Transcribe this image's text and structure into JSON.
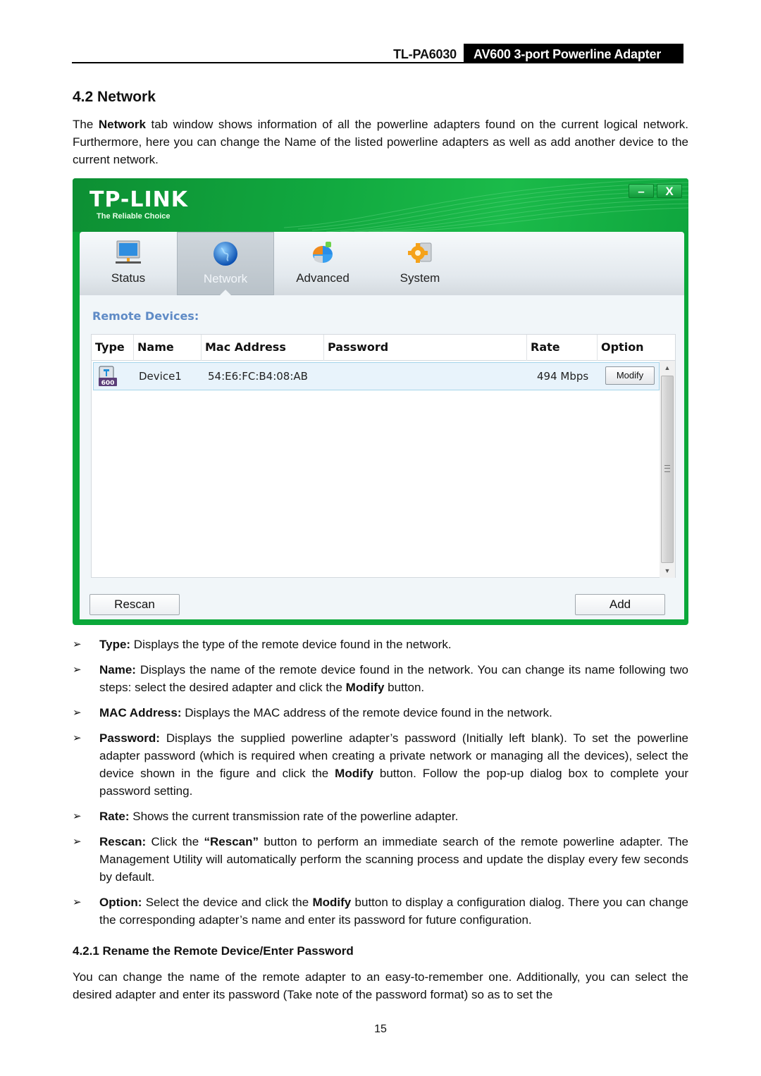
{
  "header": {
    "model": "TL-PA6030",
    "product": "AV600 3-port Powerline Adapter"
  },
  "section": {
    "title": "4.2 Network",
    "intro": {
      "pre": "The ",
      "bold": "Network",
      "post": " tab window shows information of all the powerline adapters found on the current logical network. Furthermore, here you can change the Name of the listed powerline adapters as well as add another device to the current network."
    }
  },
  "app": {
    "logo": "TP-LINK",
    "tagline": "The Reliable Choice",
    "window_controls": {
      "minimize": "–",
      "close": "X"
    },
    "tabs": [
      {
        "label": "Status",
        "icon": "monitor-icon",
        "active": false
      },
      {
        "label": "Network",
        "icon": "globe-icon",
        "active": true
      },
      {
        "label": "Advanced",
        "icon": "pie-chart-icon",
        "active": false
      },
      {
        "label": "System",
        "icon": "gear-icon",
        "active": false
      }
    ],
    "remote_title": "Remote Devices:",
    "table": {
      "columns": [
        "Type",
        "Name",
        "Mac Address",
        "Password",
        "Rate",
        "Option"
      ],
      "rows": [
        {
          "type_icon": "powerline-adapter-icon",
          "type_badge": "600",
          "name": "Device1",
          "mac": "54:E6:FC:B4:08:AB",
          "password": "",
          "rate": "494 Mbps",
          "option": "Modify"
        }
      ]
    },
    "buttons": {
      "rescan": "Rescan",
      "add": "Add"
    },
    "colors": {
      "brand_green": "#0aa83a",
      "remote_title": "#5f8bc6",
      "row_highlight": "#e8f3fb"
    }
  },
  "bullets": [
    {
      "term": "Type:",
      "text": [
        {
          "t": " Displays the type of the remote device found in the network."
        }
      ]
    },
    {
      "term": "Name:",
      "text": [
        {
          "t": " Displays the name of the remote device found in the network. You can change its name following two steps: select the desired adapter and click the "
        },
        {
          "b": "Modify"
        },
        {
          "t": " button."
        }
      ]
    },
    {
      "term": "MAC Address:",
      "text": [
        {
          "t": " Displays the MAC address of the remote device found in the network."
        }
      ]
    },
    {
      "term": "Password:",
      "text": [
        {
          "t": " Displays the supplied powerline adapter’s password (Initially left blank). To set the powerline adapter password (which is required when creating a private network or managing all the devices), select the device shown in the figure and click the "
        },
        {
          "b": "Modify"
        },
        {
          "t": " button. Follow the pop-up dialog box to complete your password setting."
        }
      ]
    },
    {
      "term": "Rate:",
      "text": [
        {
          "t": " Shows the current transmission rate of the powerline adapter."
        }
      ]
    },
    {
      "term": "Rescan:",
      "text": [
        {
          "t": " Click the "
        },
        {
          "b": "“Rescan”"
        },
        {
          "t": " button to perform an immediate search of the remote powerline adapter. The Management Utility will automatically perform the scanning process and update the display every few seconds by default."
        }
      ]
    },
    {
      "term": "Option:",
      "text": [
        {
          "t": " Select the device and click the "
        },
        {
          "b": "Modify"
        },
        {
          "t": " button to display a configuration dialog. There you can change the corresponding adapter’s name and enter its password for future configuration."
        }
      ]
    }
  ],
  "bullet_glyph": "➢",
  "subsection": {
    "title": "4.2.1 Rename the Remote Device/Enter Password",
    "text": "You can change the name of the remote adapter to an easy-to-remember one. Additionally, you can select the desired adapter and enter its password (Take note of the password format) so as to set the"
  },
  "page_number": "15"
}
